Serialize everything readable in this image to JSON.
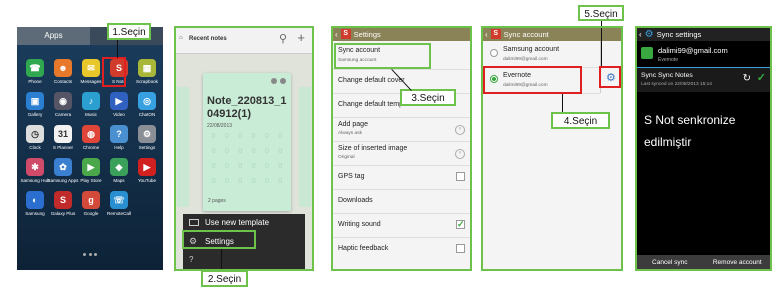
{
  "panel1": {
    "tabs": [
      "Apps",
      "W"
    ],
    "apps": [
      {
        "label": "Phone",
        "color": "#2fa84f",
        "glyph": "☎"
      },
      {
        "label": "Contacts",
        "color": "#e8782a",
        "glyph": "☻"
      },
      {
        "label": "Messages",
        "color": "#e8c72a",
        "glyph": "✉"
      },
      {
        "label": "S Note",
        "color": "#d03b2b",
        "glyph": "S"
      },
      {
        "label": "Scrapbook",
        "color": "#a8b63a",
        "glyph": "▦"
      },
      {
        "label": "Gallery",
        "color": "#2b7fd0",
        "glyph": "▣"
      },
      {
        "label": "Camera",
        "color": "#555566",
        "glyph": "◉"
      },
      {
        "label": "Music",
        "color": "#2b9fd0",
        "glyph": "♪"
      },
      {
        "label": "Video",
        "color": "#3060c0",
        "glyph": "▶"
      },
      {
        "label": "ChatON",
        "color": "#37a0e0",
        "glyph": "◎"
      },
      {
        "label": "Clock",
        "color": "#dddddd",
        "glyph": "◷"
      },
      {
        "label": "S Planner",
        "color": "#f2f2f2",
        "glyph": "31"
      },
      {
        "label": "Chrome",
        "color": "#e0453a",
        "glyph": "◍"
      },
      {
        "label": "Help",
        "color": "#4a90d0",
        "glyph": "?"
      },
      {
        "label": "Settings",
        "color": "#8a8f96",
        "glyph": "⚙"
      },
      {
        "label": "Samsung Hub",
        "color": "#d04a6a",
        "glyph": "✱"
      },
      {
        "label": "Samsung Apps",
        "color": "#3a7fd0",
        "glyph": "✿"
      },
      {
        "label": "Play Store",
        "color": "#4aa84a",
        "glyph": "▶"
      },
      {
        "label": "Maps",
        "color": "#3aa05a",
        "glyph": "◆"
      },
      {
        "label": "YouTube",
        "color": "#d02020",
        "glyph": "▶"
      },
      {
        "label": "Samsung",
        "color": "#2a6fd0",
        "glyph": "◐"
      },
      {
        "label": "Galaxy Plus",
        "color": "#c02a2a",
        "glyph": "S"
      },
      {
        "label": "Google",
        "color": "#d44a3a",
        "glyph": "g"
      },
      {
        "label": "RemoteCall",
        "color": "#2a8fd0",
        "glyph": "☏"
      }
    ],
    "callout": "1.Seçin"
  },
  "panel2": {
    "header": "Recent notes",
    "note_title": "Note_220813_104912(1)",
    "note_date": "22/08/2013",
    "note_pages": "2 pages",
    "menu": [
      "Use new template",
      "Settings"
    ],
    "callout": "2.Seçin"
  },
  "panel3": {
    "header": "Settings",
    "sync_account": "Sync account",
    "sync_sub": "Samsung account",
    "items": [
      "Change default cover",
      "Change default template",
      "Add page",
      "Size of inserted image",
      "GPS tag",
      "Downloads",
      "Writing sound",
      "Haptic feedback"
    ],
    "add_page_sub": "Always ask",
    "size_sub": "Original",
    "callout": "3.Seçin"
  },
  "panel4": {
    "header": "Sync account",
    "samsung_account": "Samsung account",
    "samsung_email": "dalimi99@gmail.com",
    "evernote": "Evernote",
    "evernote_email": "dalimi99@gmail.com",
    "callout4": "4.Seçin",
    "callout5": "5.Seçin"
  },
  "panel5": {
    "header": "Sync settings",
    "account_email": "dalimi99@gmail.com",
    "account_app": "Evernote",
    "sync_title": "Sync Sync Notes",
    "last_synced": "Last synced on 22/08/2013 15:14",
    "message_line1": "S Not senkronize",
    "message_line2": "edilmiştir",
    "cancel_sync": "Cancel sync",
    "remove_account": "Remove account"
  }
}
